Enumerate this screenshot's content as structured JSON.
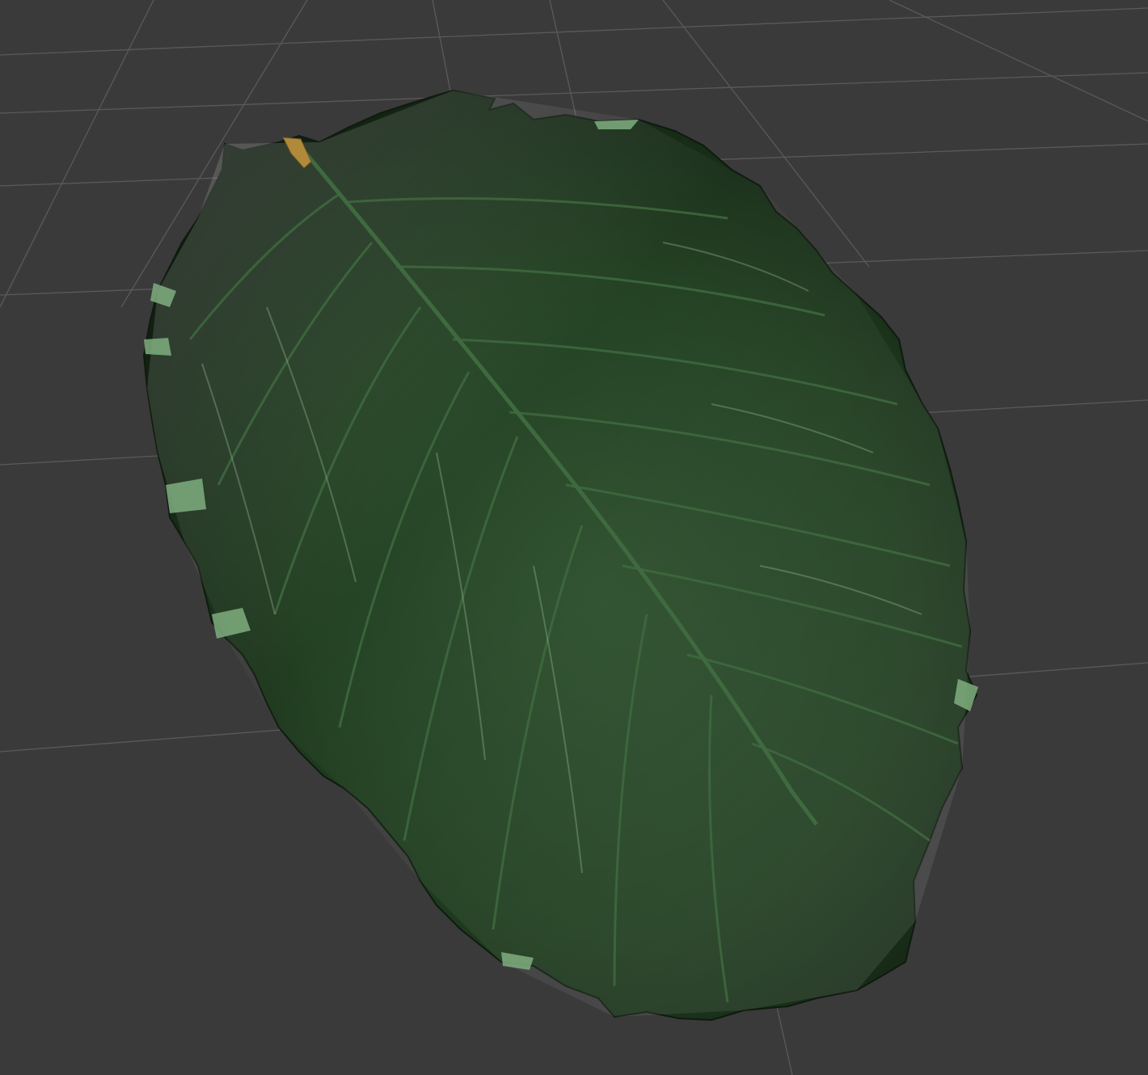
{
  "viewport": {
    "background_color": "#3a3a3a",
    "grid_line_color": "#5a5a5a",
    "grid_visible": true
  },
  "model": {
    "subject": "leaf",
    "primary_color": "#1f3d1f",
    "highlight_color": "#6f8f6f",
    "edge_color": "#7fae7f",
    "vein_color": "#3f6a3f",
    "petiole_color": "#b08a3a"
  }
}
